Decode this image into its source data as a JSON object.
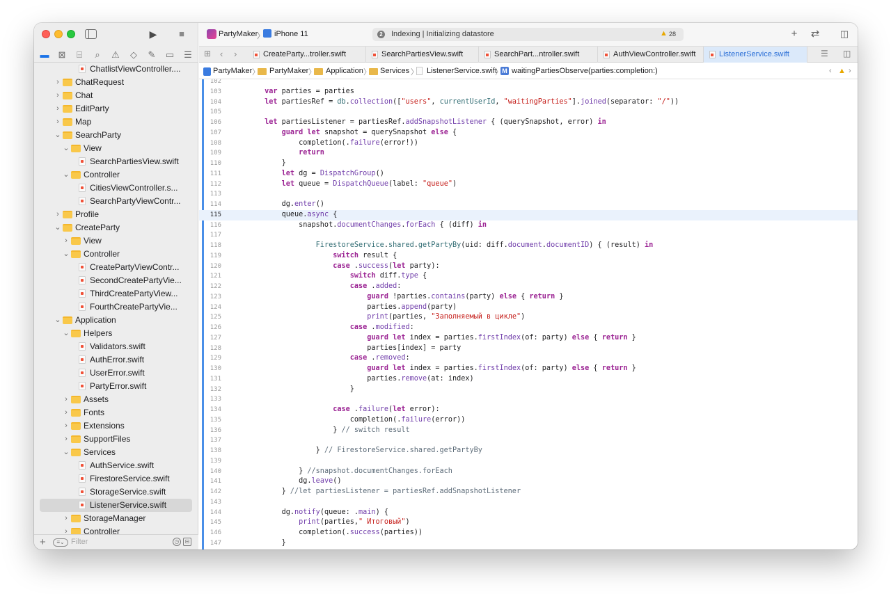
{
  "toolbar": {
    "scheme": "PartyMaker",
    "device": "iPhone 11",
    "activity_step": "2",
    "activity": "Indexing | Initializing datastore",
    "warnings": "28"
  },
  "tabs": [
    {
      "label": "CreateParty...troller.swift",
      "active": false
    },
    {
      "label": "SearchPartiesView.swift",
      "active": false
    },
    {
      "label": "SearchPart...ntroller.swift",
      "active": false
    },
    {
      "label": "AuthViewController.swift",
      "active": false
    },
    {
      "label": "ListenerService.swift",
      "active": true
    }
  ],
  "breadcrumb": [
    "PartyMaker",
    "PartyMaker",
    "Application",
    "Services",
    "ListenerService.swift",
    "waitingPartiesObserve(parties:completion:)"
  ],
  "sidebar": {
    "filter_placeholder": "Filter",
    "items": [
      {
        "label": "ChatlistViewController....",
        "indent": 2,
        "kind": "file"
      },
      {
        "label": "ChatRequest",
        "indent": 0,
        "kind": "folder",
        "chev": "›"
      },
      {
        "label": "Chat",
        "indent": 0,
        "kind": "folder",
        "chev": "›"
      },
      {
        "label": "EditParty",
        "indent": 0,
        "kind": "folder",
        "chev": "›"
      },
      {
        "label": "Map",
        "indent": 0,
        "kind": "folder",
        "chev": "›"
      },
      {
        "label": "SearchParty",
        "indent": 0,
        "kind": "folder",
        "chev": "⌄"
      },
      {
        "label": "View",
        "indent": 1,
        "kind": "folder",
        "chev": "⌄"
      },
      {
        "label": "SearchPartiesView.swift",
        "indent": 2,
        "kind": "file"
      },
      {
        "label": "Controller",
        "indent": 1,
        "kind": "folder",
        "chev": "⌄"
      },
      {
        "label": "CitiesViewController.s...",
        "indent": 2,
        "kind": "file"
      },
      {
        "label": "SearchPartyViewContr...",
        "indent": 2,
        "kind": "file"
      },
      {
        "label": "Profile",
        "indent": 0,
        "kind": "folder",
        "chev": "›"
      },
      {
        "label": "CreateParty",
        "indent": 0,
        "kind": "folder",
        "chev": "⌄"
      },
      {
        "label": "View",
        "indent": 1,
        "kind": "folder",
        "chev": "›"
      },
      {
        "label": "Controller",
        "indent": 1,
        "kind": "folder",
        "chev": "⌄"
      },
      {
        "label": "CreatePartyViewContr...",
        "indent": 2,
        "kind": "file"
      },
      {
        "label": "SecondCreatePartyVie...",
        "indent": 2,
        "kind": "file"
      },
      {
        "label": "ThirdCreatePartyView...",
        "indent": 2,
        "kind": "file"
      },
      {
        "label": "FourthCreatePartyVie...",
        "indent": 2,
        "kind": "file"
      },
      {
        "label": "Application",
        "indent": 0,
        "kind": "folder",
        "chev": "⌄"
      },
      {
        "label": "Helpers",
        "indent": 1,
        "kind": "folder",
        "chev": "⌄"
      },
      {
        "label": "Validators.swift",
        "indent": 2,
        "kind": "file"
      },
      {
        "label": "AuthError.swift",
        "indent": 2,
        "kind": "file"
      },
      {
        "label": "UserError.swift",
        "indent": 2,
        "kind": "file"
      },
      {
        "label": "PartyError.swift",
        "indent": 2,
        "kind": "file"
      },
      {
        "label": "Assets",
        "indent": 1,
        "kind": "folder",
        "chev": "›"
      },
      {
        "label": "Fonts",
        "indent": 1,
        "kind": "folder",
        "chev": "›"
      },
      {
        "label": "Extensions",
        "indent": 1,
        "kind": "folder",
        "chev": "›"
      },
      {
        "label": "SupportFiles",
        "indent": 1,
        "kind": "folder",
        "chev": "›"
      },
      {
        "label": "Services",
        "indent": 1,
        "kind": "folder",
        "chev": "⌄"
      },
      {
        "label": "AuthService.swift",
        "indent": 2,
        "kind": "file"
      },
      {
        "label": "FirestoreService.swift",
        "indent": 2,
        "kind": "file"
      },
      {
        "label": "StorageService.swift",
        "indent": 2,
        "kind": "file"
      },
      {
        "label": "ListenerService.swift",
        "indent": 2,
        "kind": "file",
        "selected": true
      },
      {
        "label": "StorageManager",
        "indent": 1,
        "kind": "folder",
        "chev": "›"
      },
      {
        "label": "Controller",
        "indent": 1,
        "kind": "folder",
        "chev": "›"
      }
    ]
  },
  "editor": {
    "current_line": "115",
    "lines": [
      {
        "n": "102",
        "t": ""
      },
      {
        "n": "103",
        "t": "        <span class=\"kw\">var</span> parties = parties"
      },
      {
        "n": "104",
        "t": "        <span class=\"kw\">let</span> partiesRef = <span class=\"fn\">db</span>.<span class=\"ty\">collection</span>([<span class=\"str\">\"users\"</span>, <span class=\"fn\">currentUserId</span>, <span class=\"str\">\"waitingParties\"</span>].<span class=\"ty\">joined</span>(separator: <span class=\"str\">\"/\"</span>))"
      },
      {
        "n": "105",
        "t": ""
      },
      {
        "n": "106",
        "t": "        <span class=\"kw\">let</span> partiesListener = partiesRef.<span class=\"ty\">addSnapshotListener</span> { (querySnapshot, error) <span class=\"kw\">in</span>"
      },
      {
        "n": "107",
        "t": "            <span class=\"kw\">guard</span> <span class=\"kw\">let</span> snapshot = querySnapshot <span class=\"kw\">else</span> {"
      },
      {
        "n": "108",
        "t": "                completion(.<span class=\"ty\">failure</span>(error!))"
      },
      {
        "n": "109",
        "t": "                <span class=\"kw\">return</span>"
      },
      {
        "n": "110",
        "t": "            }"
      },
      {
        "n": "111",
        "t": "            <span class=\"kw\">let</span> dg = <span class=\"ty\">DispatchGroup</span>()"
      },
      {
        "n": "112",
        "t": "            <span class=\"kw\">let</span> queue = <span class=\"ty\">DispatchQueue</span>(label: <span class=\"str\">\"queue\"</span>)"
      },
      {
        "n": "113",
        "t": ""
      },
      {
        "n": "114",
        "t": "            dg.<span class=\"ty\">enter</span>()"
      },
      {
        "n": "115",
        "t": "            queue.<span class=\"ty\">async</span> {"
      },
      {
        "n": "116",
        "t": "                snapshot.<span class=\"ty\">documentChanges</span>.<span class=\"ty\">forEach</span> { (diff) <span class=\"kw\">in</span>"
      },
      {
        "n": "117",
        "t": ""
      },
      {
        "n": "118",
        "t": "                    <span class=\"fn\">FirestoreService</span>.<span class=\"fn\">shared</span>.<span class=\"fn\">getPartyBy</span>(uid: diff.<span class=\"ty\">document</span>.<span class=\"ty\">documentID</span>) { (result) <span class=\"kw\">in</span>"
      },
      {
        "n": "119",
        "t": "                        <span class=\"kw\">switch</span> result {"
      },
      {
        "n": "120",
        "t": "                        <span class=\"kw\">case</span> .<span class=\"ty\">success</span>(<span class=\"kw\">let</span> party):"
      },
      {
        "n": "121",
        "t": "                            <span class=\"kw\">switch</span> diff.<span class=\"ty\">type</span> {"
      },
      {
        "n": "122",
        "t": "                            <span class=\"kw\">case</span> .<span class=\"ty\">added</span>:"
      },
      {
        "n": "123",
        "t": "                                <span class=\"kw\">guard</span> !parties.<span class=\"ty\">contains</span>(party) <span class=\"kw\">else</span> { <span class=\"kw\">return</span> }"
      },
      {
        "n": "124",
        "t": "                                parties.<span class=\"ty\">append</span>(party)"
      },
      {
        "n": "125",
        "t": "                                <span class=\"ty\">print</span>(parties, <span class=\"str\">\"Заполняемый в цикле\"</span>)"
      },
      {
        "n": "126",
        "t": "                            <span class=\"kw\">case</span> .<span class=\"ty\">modified</span>:"
      },
      {
        "n": "127",
        "t": "                                <span class=\"kw\">guard</span> <span class=\"kw\">let</span> index = parties.<span class=\"ty\">firstIndex</span>(of: party) <span class=\"kw\">else</span> { <span class=\"kw\">return</span> }"
      },
      {
        "n": "128",
        "t": "                                parties[index] = party"
      },
      {
        "n": "129",
        "t": "                            <span class=\"kw\">case</span> .<span class=\"ty\">removed</span>:"
      },
      {
        "n": "130",
        "t": "                                <span class=\"kw\">guard</span> <span class=\"kw\">let</span> index = parties.<span class=\"ty\">firstIndex</span>(of: party) <span class=\"kw\">else</span> { <span class=\"kw\">return</span> }"
      },
      {
        "n": "131",
        "t": "                                parties.<span class=\"ty\">remove</span>(at: index)"
      },
      {
        "n": "132",
        "t": "                            }"
      },
      {
        "n": "133",
        "t": ""
      },
      {
        "n": "134",
        "t": "                        <span class=\"kw\">case</span> .<span class=\"ty\">failure</span>(<span class=\"kw\">let</span> error):"
      },
      {
        "n": "135",
        "t": "                            completion(.<span class=\"ty\">failure</span>(error))"
      },
      {
        "n": "136",
        "t": "                        } <span class=\"cm\">// switch result</span>"
      },
      {
        "n": "137",
        "t": ""
      },
      {
        "n": "138",
        "t": "                    } <span class=\"cm\">// FirestoreService.shared.getPartyBy</span>"
      },
      {
        "n": "139",
        "t": ""
      },
      {
        "n": "140",
        "t": "                } <span class=\"cm\">//snapshot.documentChanges.forEach</span>"
      },
      {
        "n": "141",
        "t": "                dg.<span class=\"ty\">leave</span>()"
      },
      {
        "n": "142",
        "t": "            } <span class=\"cm\">//let partiesListener = partiesRef.addSnapshotListener</span>"
      },
      {
        "n": "143",
        "t": ""
      },
      {
        "n": "144",
        "t": "            dg.<span class=\"ty\">notify</span>(queue: .<span class=\"ty\">main</span>) {"
      },
      {
        "n": "145",
        "t": "                <span class=\"ty\">print</span>(parties,<span class=\"str\">\" Итоговый\"</span>)"
      },
      {
        "n": "146",
        "t": "                completion(.<span class=\"ty\">success</span>(parties))"
      },
      {
        "n": "147",
        "t": "            }"
      }
    ]
  }
}
